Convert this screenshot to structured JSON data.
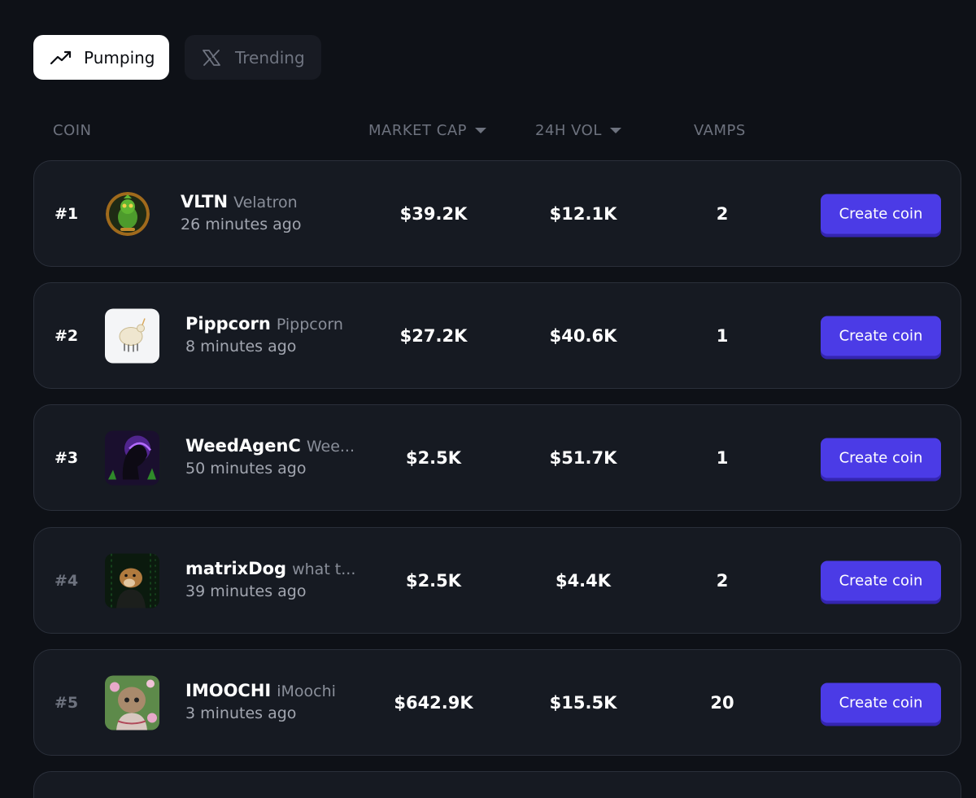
{
  "tabs": [
    {
      "label": "Pumping",
      "icon": "trending-up-icon",
      "active": true
    },
    {
      "label": "Trending",
      "icon": "x-logo-icon",
      "active": false
    }
  ],
  "header": {
    "coin": "COIN",
    "market_cap": "MARKET CAP",
    "vol_24h": "24H VOL",
    "vamps": "VAMPS"
  },
  "coins": [
    {
      "rank": "#1",
      "symbol": "VLTN",
      "name": "Velatron",
      "time": "26 minutes ago",
      "market_cap": "$39.2K",
      "vol_24h": "$12.1K",
      "vamps": "2",
      "button": "Create coin"
    },
    {
      "rank": "#2",
      "symbol": "Pippcorn",
      "name": "Pippcorn",
      "time": "8 minutes ago",
      "market_cap": "$27.2K",
      "vol_24h": "$40.6K",
      "vamps": "1",
      "button": "Create coin"
    },
    {
      "rank": "#3",
      "symbol": "WeedAgenC",
      "name": "Wee...",
      "time": "50 minutes ago",
      "market_cap": "$2.5K",
      "vol_24h": "$51.7K",
      "vamps": "1",
      "button": "Create coin"
    },
    {
      "rank": "#4",
      "symbol": "matrixDog",
      "name": "what t...",
      "time": "39 minutes ago",
      "market_cap": "$2.5K",
      "vol_24h": "$4.4K",
      "vamps": "2",
      "button": "Create coin"
    },
    {
      "rank": "#5",
      "symbol": "IMOOCHI",
      "name": "iMoochi",
      "time": "3 minutes ago",
      "market_cap": "$642.9K",
      "vol_24h": "$15.5K",
      "vamps": "20",
      "button": "Create coin"
    }
  ],
  "colors": {
    "background": "#0e1117",
    "row_bg": "#161a22",
    "accent": "#4b3be6"
  }
}
